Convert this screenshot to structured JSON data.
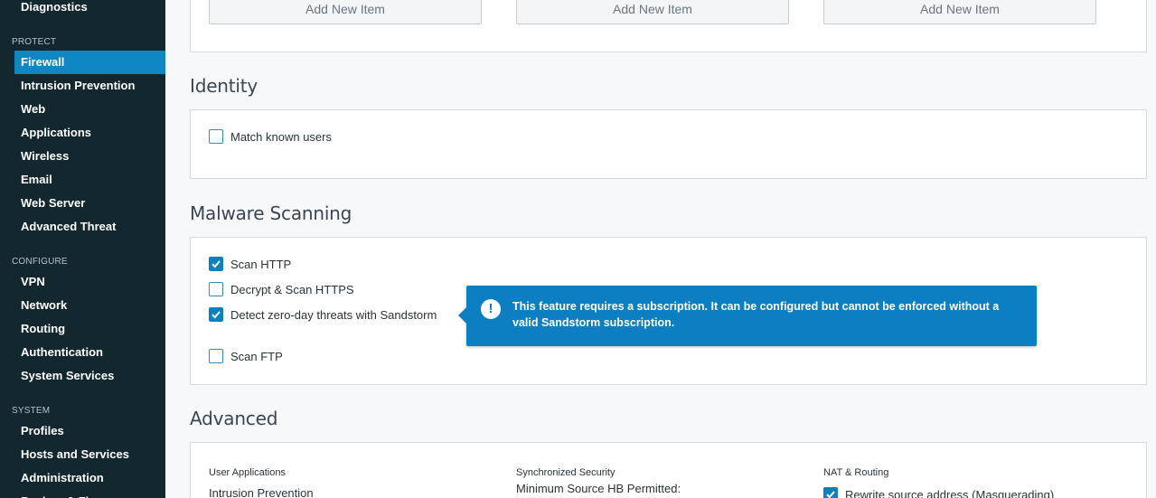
{
  "sidebar": {
    "top_item": "Diagnostics",
    "groups": {
      "protect": "PROTECT",
      "configure": "CONFIGURE",
      "system": "SYSTEM"
    },
    "protect_items": [
      "Firewall",
      "Intrusion Prevention",
      "Web",
      "Applications",
      "Wireless",
      "Email",
      "Web Server",
      "Advanced Threat"
    ],
    "configure_items": [
      "VPN",
      "Network",
      "Routing",
      "Authentication",
      "System Services"
    ],
    "system_items": [
      "Profiles",
      "Hosts and Services",
      "Administration",
      "Backup & Firmware"
    ],
    "active_item": "Firewall"
  },
  "top_panel": {
    "add_buttons": [
      "Add New Item",
      "Add New Item",
      "Add New Item"
    ]
  },
  "identity": {
    "title": "Identity",
    "match_known_users": {
      "label": "Match known users",
      "checked": false
    }
  },
  "malware": {
    "title": "Malware Scanning",
    "options": [
      {
        "label": "Scan HTTP",
        "checked": true
      },
      {
        "label": "Decrypt & Scan HTTPS",
        "checked": false
      },
      {
        "label": "Detect zero-day threats with Sandstorm",
        "checked": true
      },
      {
        "label": "Scan FTP",
        "checked": false
      }
    ],
    "tooltip": "This feature requires a subscription. It can be configured but cannot be enforced without a valid Sandstorm subscription."
  },
  "advanced": {
    "title": "Advanced",
    "user_applications": {
      "title": "User Applications",
      "value": "Intrusion Prevention"
    },
    "synchronized_security": {
      "title": "Synchronized Security",
      "value": "Minimum Source HB Permitted:"
    },
    "nat_routing": {
      "title": "NAT & Routing",
      "value": "Rewrite source address (Masquerading)",
      "checked": true
    }
  },
  "colors": {
    "sidebar_bg": "#13272f",
    "accent": "#0f87c5",
    "tooltip_bg": "#0c7fc2"
  }
}
